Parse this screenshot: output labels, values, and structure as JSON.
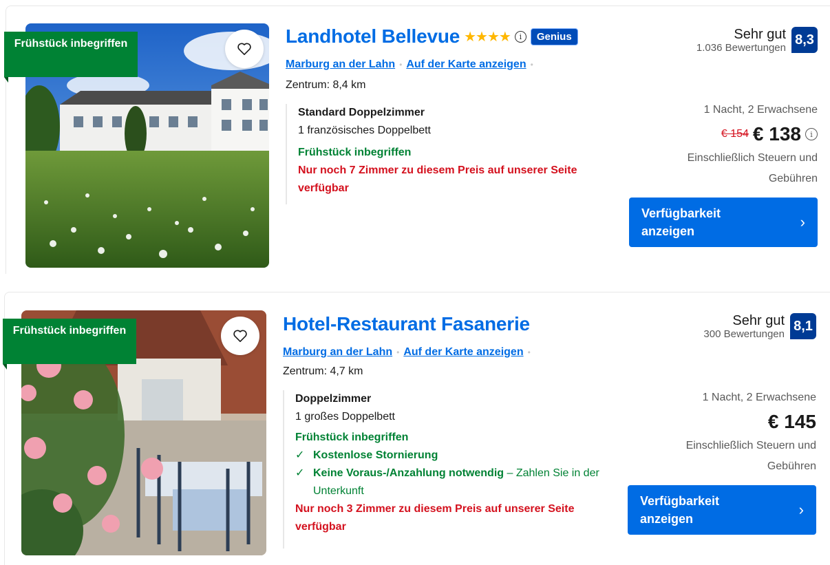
{
  "hotels": [
    {
      "ribbon": "Frühstück inbegriffen",
      "name": "Landhotel Bellevue",
      "stars": "★★★★",
      "stars_count": 4,
      "genius": "Genius",
      "city": "Marburg an der Lahn",
      "map_link": "Auf der Karte anzeigen",
      "distance": "Zentrum: 8,4 km",
      "room_type": "Standard Doppelzimmer",
      "bed": "1 französisches Doppelbett",
      "breakfast": "Frühstück inbegriffen",
      "availability_warning": "Nur noch 7 Zimmer zu diesem Preis auf unserer Seite verfügbar",
      "rating_word": "Sehr gut",
      "review_count": "1.036 Bewertungen",
      "score": "8,3",
      "occupancy": "1 Nacht, 2 Erwachsene",
      "old_price": "€ 154",
      "price": "€ 138",
      "taxes": "Einschließlich Steuern und Gebühren",
      "cta": "Verfügbarkeit anzeigen"
    },
    {
      "ribbon": "Frühstück inbegriffen",
      "name": "Hotel-Restaurant Fasanerie",
      "city": "Marburg an der Lahn",
      "map_link": "Auf der Karte anzeigen",
      "distance": "Zentrum: 4,7 km",
      "room_type": "Doppelzimmer",
      "bed": "1 großes Doppelbett",
      "breakfast": "Frühstück inbegriffen",
      "free_cancellation": "Kostenlose Stornierung",
      "no_prepayment": "Keine Voraus-/Anzahlung notwendig",
      "pay_at_property": "– Zahlen Sie in der Unterkunft",
      "availability_warning": "Nur noch 3 Zimmer zu diesem Preis auf unserer Seite verfügbar",
      "rating_word": "Sehr gut",
      "review_count": "300 Bewertungen",
      "score": "8,1",
      "occupancy": "1 Nacht, 2 Erwachsene",
      "price": "€ 145",
      "taxes": "Einschließlich Steuern und Gebühren",
      "cta": "Verfügbarkeit anzeigen"
    }
  ],
  "icons": {
    "favorite": "heart-outline-icon",
    "info": "info-circle-icon",
    "check": "checkmark-icon",
    "chevron": "chevron-right-icon"
  },
  "colors": {
    "brand_blue": "#006ce4",
    "score_blue": "#003b95",
    "green": "#008234",
    "red": "#d4111e",
    "stars": "#ffb700"
  }
}
